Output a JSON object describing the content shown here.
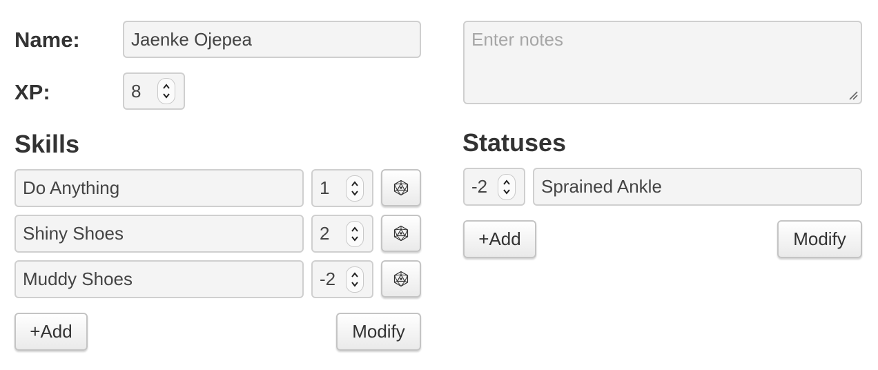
{
  "character": {
    "name_label": "Name:",
    "name_value": "Jaenke Ojepea",
    "xp_label": "XP:",
    "xp_value": "8"
  },
  "notes": {
    "placeholder": "Enter notes"
  },
  "skills": {
    "heading": "Skills",
    "items": [
      {
        "name": "Do Anything",
        "value": "1"
      },
      {
        "name": "Shiny Shoes",
        "value": "2"
      },
      {
        "name": "Muddy Shoes",
        "value": "-2"
      }
    ],
    "add_label": "+Add",
    "modify_label": "Modify",
    "roll_icon": "d20-dice-icon"
  },
  "statuses": {
    "heading": "Statuses",
    "items": [
      {
        "value": "-2",
        "name": "Sprained Ankle"
      }
    ],
    "add_label": "+Add",
    "modify_label": "Modify"
  }
}
